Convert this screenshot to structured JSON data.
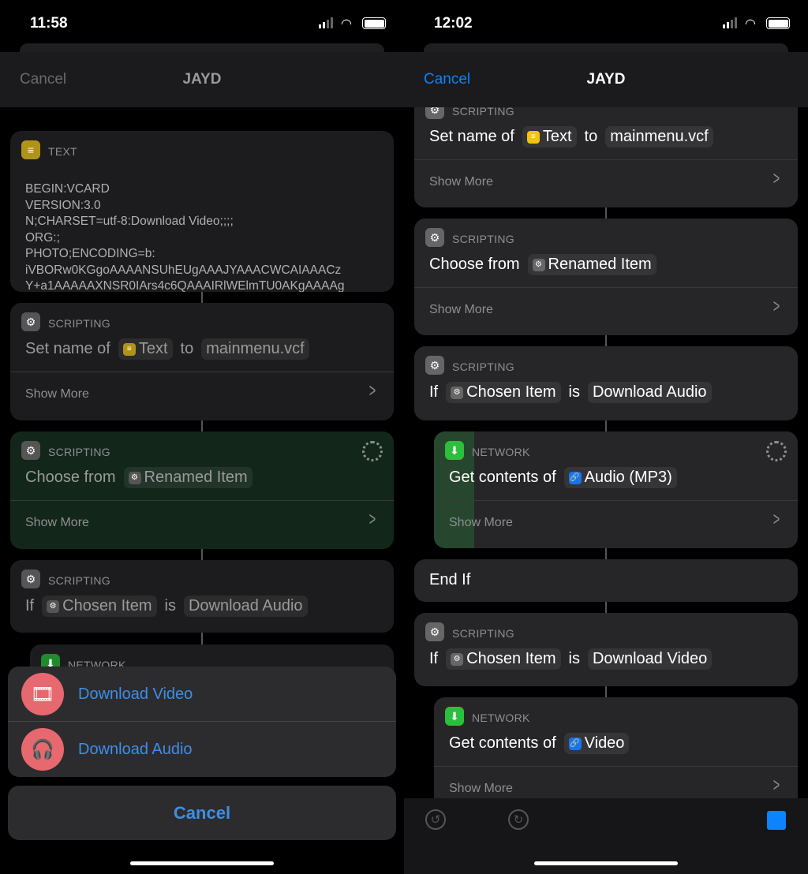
{
  "left": {
    "status_time": "11:58",
    "nav": {
      "cancel": "Cancel",
      "title": "JAYD"
    },
    "cards": [
      {
        "category": "TEXT",
        "icon": "text-icon",
        "color": "#b09318",
        "vcard": "BEGIN:VCARD\nVERSION:3.0\nN;CHARSET=utf-8:Download Video;;;;\nORG:;\nPHOTO;ENCODING=b:\niVBORw0KGgoAAAANSUhEUgAAAJYAAACWCAIAAACz\nY+a1AAAAAXNSR0IArs4c6QAAAIRlWElmTU0AKgAAAAg"
      },
      {
        "category": "SCRIPTING",
        "icon": "gear-icon",
        "color": "#555",
        "params": [
          {
            "t": "Set name of"
          },
          {
            "chip": "Text",
            "icon": "text-icon",
            "color": "#b09318"
          },
          {
            "t": "to"
          },
          {
            "chip": "mainmenu.vcf"
          }
        ],
        "show_more": "Show More"
      },
      {
        "category": "SCRIPTING",
        "icon": "gear-icon",
        "color": "#555",
        "running": true,
        "params": [
          {
            "t": "Choose from"
          },
          {
            "chip": "Renamed Item",
            "icon": "gear-icon",
            "color": "#555"
          }
        ],
        "show_more": "Show More"
      },
      {
        "category": "SCRIPTING",
        "icon": "gear-icon",
        "color": "#555",
        "params": [
          {
            "t": "If"
          },
          {
            "chip": "Chosen Item",
            "icon": "gear-icon",
            "color": "#555"
          },
          {
            "t": "is"
          },
          {
            "chip": "Download Audio"
          }
        ]
      },
      {
        "category": "NETWORK",
        "icon": "download-icon",
        "color": "#1f8a2e"
      }
    ],
    "sheet": {
      "options": [
        {
          "label": "Download Video",
          "icon": "film-icon"
        },
        {
          "label": "Download Audio",
          "icon": "headphones-icon"
        }
      ],
      "cancel": "Cancel"
    }
  },
  "right": {
    "status_time": "12:02",
    "nav": {
      "cancel": "Cancel",
      "title": "JAYD"
    },
    "cards": [
      {
        "category": "SCRIPTING",
        "icon": "gear-icon",
        "color": "#666",
        "params": [
          {
            "t": "Set name of"
          },
          {
            "chip": "Text",
            "icon": "text-icon",
            "color": "#f2c40f"
          },
          {
            "t": "to"
          },
          {
            "chip": "mainmenu.vcf"
          }
        ],
        "show_more": "Show More"
      },
      {
        "category": "SCRIPTING",
        "icon": "gear-icon",
        "color": "#666",
        "params": [
          {
            "t": "Choose from"
          },
          {
            "chip": "Renamed Item",
            "icon": "gear-icon",
            "color": "#666"
          }
        ],
        "show_more": "Show More"
      },
      {
        "category": "SCRIPTING",
        "icon": "gear-icon",
        "color": "#666",
        "params": [
          {
            "t": "If"
          },
          {
            "chip": "Chosen Item",
            "icon": "gear-icon",
            "color": "#666"
          },
          {
            "t": "is"
          },
          {
            "chip": "Download Audio"
          }
        ]
      },
      {
        "category": "NETWORK",
        "icon": "download-icon",
        "color": "#2cbf3c",
        "running": true,
        "progress": 0.11,
        "params": [
          {
            "t": "Get contents of"
          },
          {
            "chip": "Audio (MP3)",
            "icon": "link-icon",
            "color": "#1a73e8"
          }
        ],
        "show_more": "Show More"
      },
      {
        "plain": "End If"
      },
      {
        "category": "SCRIPTING",
        "icon": "gear-icon",
        "color": "#666",
        "params": [
          {
            "t": "If"
          },
          {
            "chip": "Chosen Item",
            "icon": "gear-icon",
            "color": "#666"
          },
          {
            "t": "is"
          },
          {
            "chip": "Download Video"
          }
        ]
      },
      {
        "category": "NETWORK",
        "icon": "download-icon",
        "color": "#2cbf3c",
        "params": [
          {
            "t": "Get contents of"
          },
          {
            "chip": "Video",
            "icon": "link-icon",
            "color": "#1a73e8"
          }
        ],
        "show_more": "Show More"
      }
    ],
    "toolbar": {
      "undo": "undo-icon",
      "redo": "redo-icon",
      "stop": "stop-icon"
    }
  },
  "colors": {
    "accent": "#0a84ff",
    "sheet_icon": "#e8686f",
    "progress": "#2cbf3c"
  }
}
